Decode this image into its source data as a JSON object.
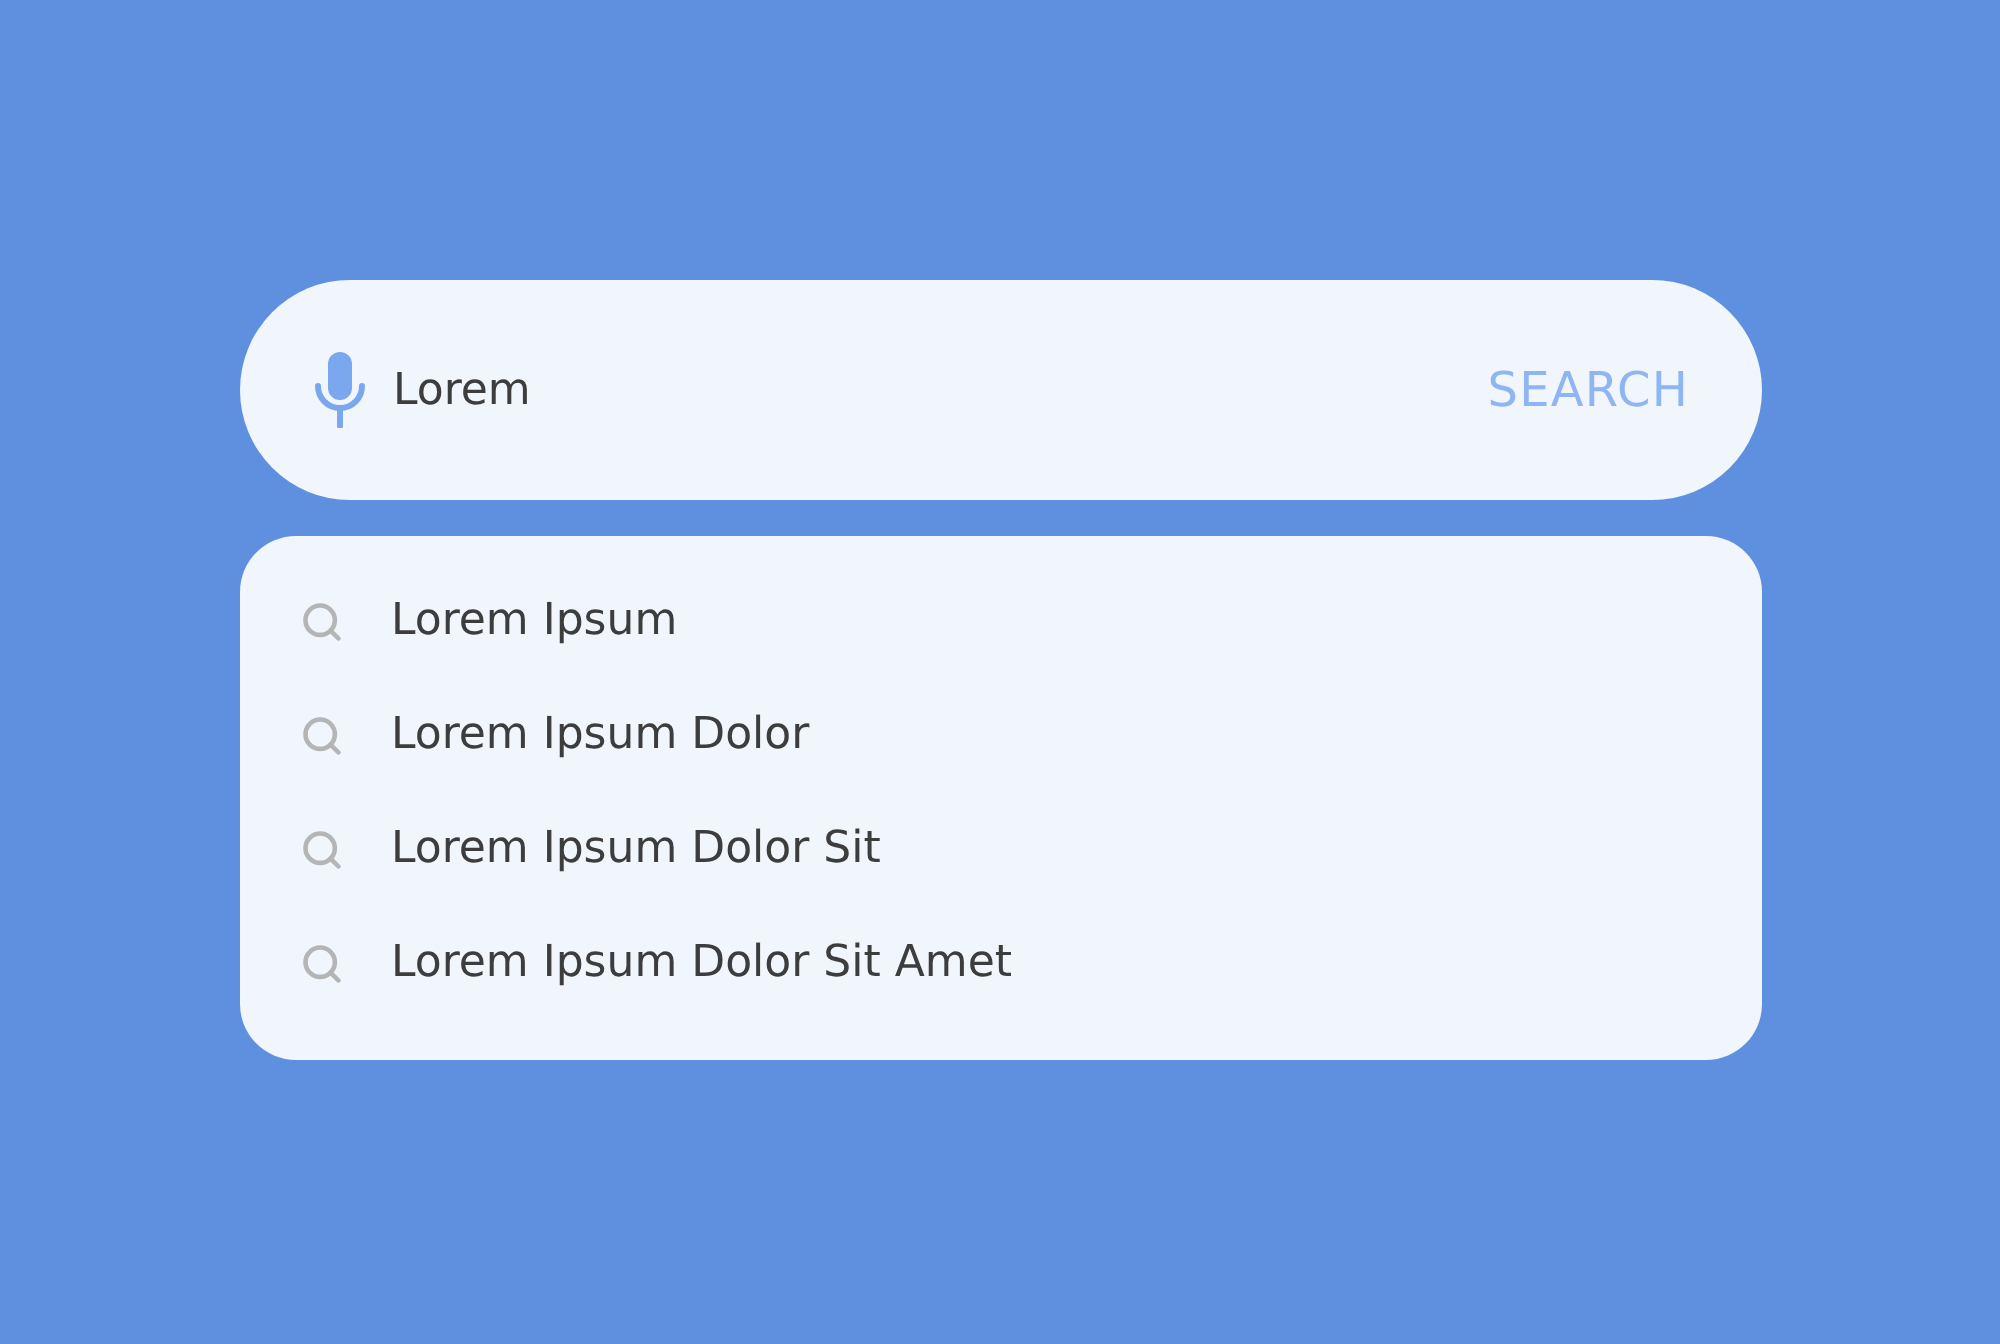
{
  "search": {
    "value": "Lorem",
    "button": "SEARCH"
  },
  "suggestions": [
    {
      "text": "Lorem Ipsum"
    },
    {
      "text": "Lorem Ipsum Dolor"
    },
    {
      "text": "Lorem Ipsum Dolor Sit"
    },
    {
      "text": "Lorem Ipsum Dolor Sit Amet"
    }
  ]
}
